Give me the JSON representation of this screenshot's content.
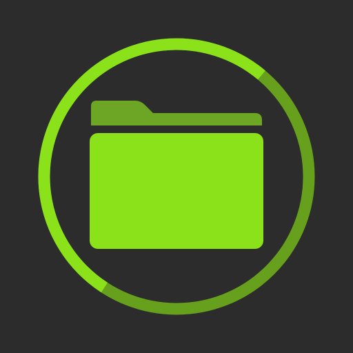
{
  "icon": {
    "semantic": "folder-icon",
    "ring_semantic": "progress-ring"
  },
  "colors": {
    "background": "#2c2c2c",
    "accent": "#8be21a",
    "accent_dark": "#66a01c",
    "folder_tab": "#6da524"
  }
}
